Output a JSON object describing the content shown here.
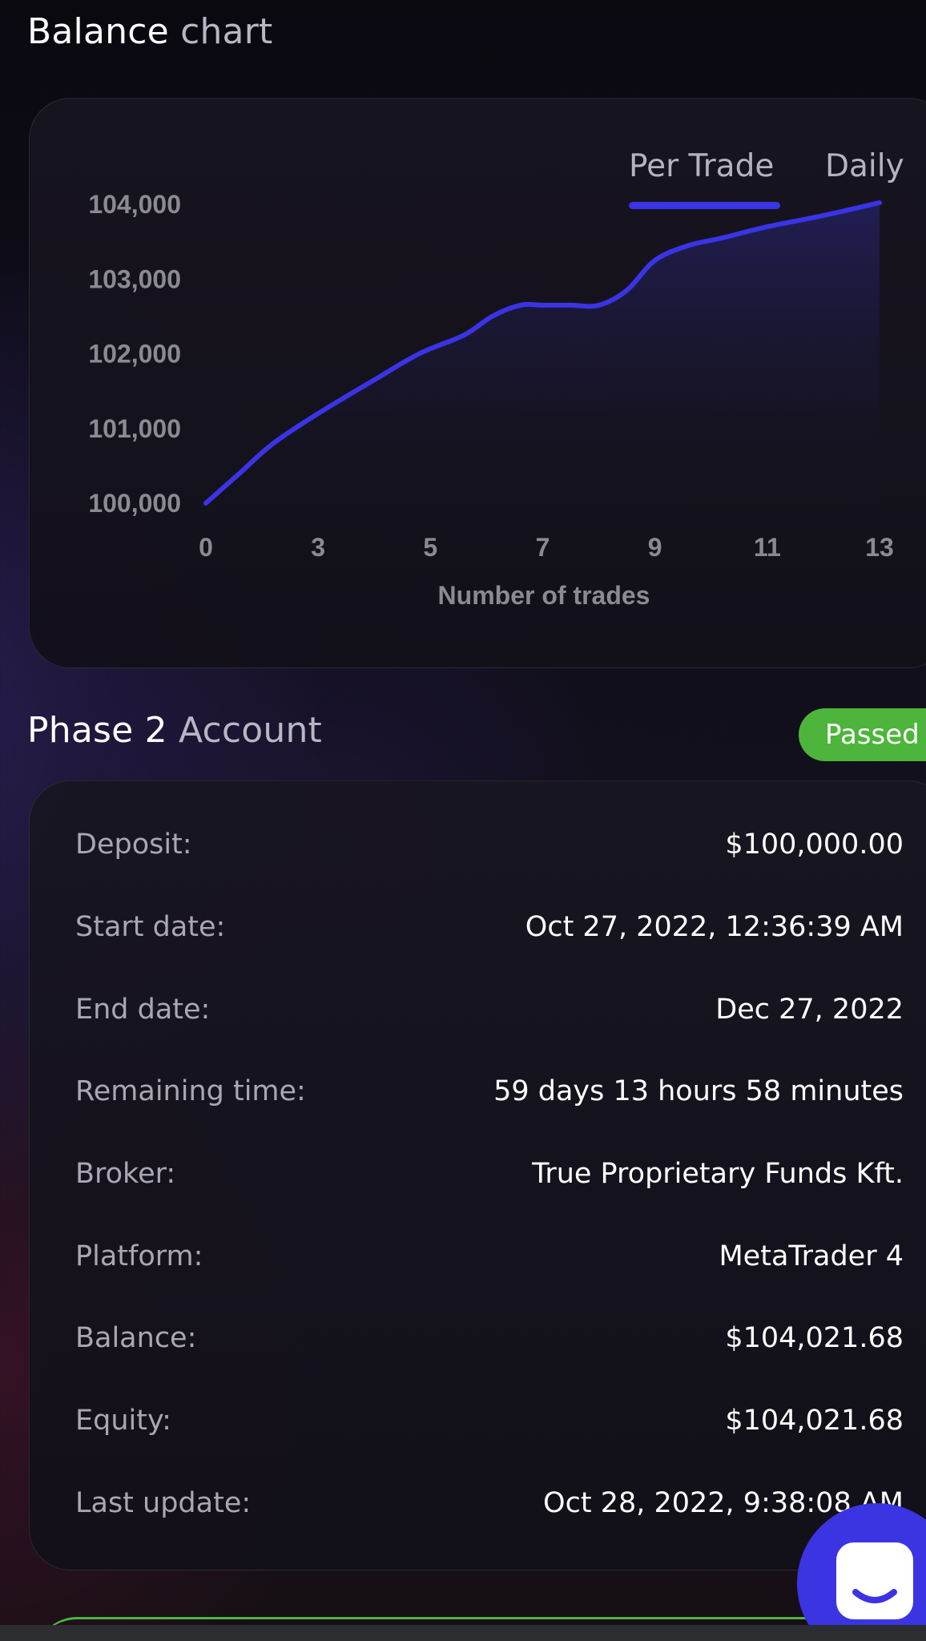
{
  "balance_chart": {
    "title_word1": "Balance",
    "title_word2": "chart",
    "tabs": [
      {
        "label": "Per Trade",
        "active": true
      },
      {
        "label": "Daily",
        "active": false
      }
    ]
  },
  "chart_data": {
    "type": "area",
    "title": "",
    "xlabel": "Number of trades",
    "ylabel": "",
    "x_ticks": [
      "0",
      "3",
      "5",
      "7",
      "9",
      "11",
      "13"
    ],
    "y_ticks": [
      "100,000",
      "101,000",
      "102,000",
      "103,000",
      "104,000"
    ],
    "xlim": [
      0,
      12
    ],
    "ylim": [
      100000,
      104000
    ],
    "grid": false,
    "x": [
      0,
      0.6,
      1.2,
      2,
      3,
      3.8,
      4.6,
      5.1,
      5.6,
      6.0,
      6.5,
      7.0,
      7.5,
      8.0,
      8.6,
      9.2,
      10,
      11,
      12
    ],
    "values": [
      100000,
      100400,
      100800,
      101200,
      101650,
      102000,
      102250,
      102500,
      102650,
      102650,
      102650,
      102650,
      102850,
      103250,
      103450,
      103550,
      103700,
      103850,
      104021.68
    ],
    "line_color": "#3a34e6"
  },
  "account": {
    "title_word1": "Phase 2",
    "title_word2": "Account",
    "status": "Passed",
    "status_color": "#4db53b",
    "rows": [
      {
        "label": "Deposit:",
        "value": "$100,000.00"
      },
      {
        "label": "Start date:",
        "value": "Oct 27, 2022, 12:36:39 AM"
      },
      {
        "label": "End date:",
        "value": "Dec 27, 2022"
      },
      {
        "label": "Remaining time:",
        "value": "59 days 13 hours 58 minutes"
      },
      {
        "label": "Broker:",
        "value": "True Proprietary Funds Kft."
      },
      {
        "label": "Platform:",
        "value": "MetaTrader 4"
      },
      {
        "label": "Balance:",
        "value": "$104,021.68"
      },
      {
        "label": "Equity:",
        "value": "$104,021.68"
      },
      {
        "label": "Last update:",
        "value": "Oct 28, 2022, 9:38:08 AM"
      }
    ]
  },
  "chat": {
    "icon": "chat-bubble-icon",
    "accent": "#3b34e3"
  }
}
